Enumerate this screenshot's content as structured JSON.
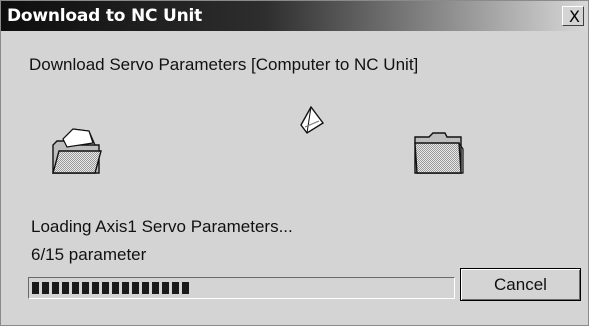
{
  "window": {
    "title": "Download to NC Unit",
    "close_glyph": "X"
  },
  "main": {
    "heading": "Download Servo Parameters [Computer to NC Unit]",
    "source_icon": "open-folder-icon",
    "moving_icon": "flying-paper-icon",
    "target_icon": "folder-icon"
  },
  "status": {
    "message": "Loading Axis1 Servo Parameters...",
    "count": "6/15 parameter"
  },
  "progress": {
    "fraction": 0.4
  },
  "buttons": {
    "cancel_label": "Cancel"
  }
}
